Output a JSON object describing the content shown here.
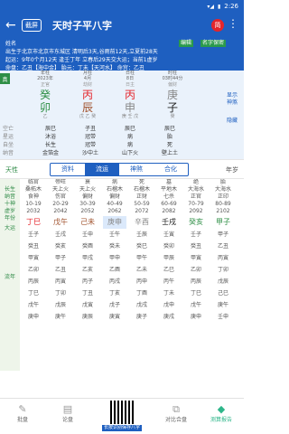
{
  "status": {
    "time": "2:26"
  },
  "header": {
    "screenshot_btn": "截屏",
    "title": "天时子平八字",
    "simp_badge": "简"
  },
  "info": {
    "line1": "姓名",
    "line2": "出生于北京市北京市东城区 清明后3天,谷雨前12天,立夏前28天",
    "line3": "起运：9年0个月12天 逢壬丁年 立春后29天交大运；当前1虚岁",
    "line4": "命盘：乙丑【海中金】 胎元：丁未【天河水】 命宫：乙丑",
    "tag1": "编辑",
    "tag2": "名字保密"
  },
  "pillars": {
    "tab": "真",
    "cols": [
      {
        "label": "年柱",
        "year": "2023年",
        "gs": "正官",
        "stem": "癸",
        "branch": "卯",
        "stem_color": "#2f8f46",
        "branch_color": "#2f8f46",
        "cang": "乙"
      },
      {
        "label": "月柱",
        "year": "4月",
        "gs": "劫财",
        "stem": "丙",
        "branch": "辰",
        "stem_color": "#e4252b",
        "branch_color": "#a0522d",
        "cang": "戊 乙 癸"
      },
      {
        "label": "日柱",
        "year": "8日",
        "gs": "日主",
        "stem": "丙",
        "branch": "申",
        "stem_color": "#e4252b",
        "branch_color": "#888",
        "cang": "庚 壬 戊"
      },
      {
        "label": "时柱",
        "year": "03时44分",
        "gs": "偏财",
        "stem": "庚",
        "branch": "子",
        "stem_color": "#888",
        "branch_color": "#222",
        "cang": "癸"
      }
    ],
    "links": [
      "显示",
      "神煞",
      "隐藏"
    ],
    "rows": [
      {
        "label": "空亡",
        "vals": [
          "辰巳",
          "子丑",
          "辰巳",
          "辰巳"
        ]
      },
      {
        "label": "星运",
        "vals": [
          "沐浴",
          "冠带",
          "病",
          "胎"
        ]
      },
      {
        "label": "自坐",
        "vals": [
          "长生",
          "冠带",
          "病",
          "死"
        ]
      },
      {
        "label": "纳音",
        "vals": [
          "金箔金",
          "沙中土",
          "山下火",
          "壁上土"
        ]
      }
    ]
  },
  "tabs": {
    "left": "天性",
    "items": [
      "资料",
      "流运",
      "神煞",
      "合化"
    ],
    "active": 1,
    "right": "年岁"
  },
  "dayun": {
    "side": [
      "长生",
      "纳音",
      "十神",
      "虚岁",
      "年份"
    ],
    "side2": "大运",
    "side3": "流年",
    "cols": [
      {
        "a": "临官",
        "b": "桑柘木",
        "c": "食神",
        "d": "10-19",
        "e": "2032",
        "gz": "丁巳",
        "g1": "#e4252b",
        "g2": "#e4252b"
      },
      {
        "a": "帝旺",
        "b": "天上火",
        "c": "伤官",
        "d": "20-29",
        "e": "2042",
        "gz": "戊午",
        "g1": "#a0522d",
        "g2": "#e4252b"
      },
      {
        "a": "衰",
        "b": "天上火",
        "c": "偏财",
        "d": "30-39",
        "e": "2052",
        "gz": "己未",
        "g1": "#a0522d",
        "g2": "#a0522d"
      },
      {
        "a": "病",
        "b": "石榴木",
        "c": "偏财",
        "d": "40-49",
        "e": "2062",
        "gz": "庚申",
        "g1": "#888",
        "g2": "#888",
        "hl": true
      },
      {
        "a": "死",
        "b": "石榴木",
        "c": "正财",
        "d": "50-59",
        "e": "2072",
        "gz": "辛酉",
        "g1": "#888",
        "g2": "#888"
      },
      {
        "a": "墓",
        "b": "平地木",
        "c": "七杀",
        "d": "60-69",
        "e": "2082",
        "gz": "壬戌",
        "g1": "#222",
        "g2": "#a0522d"
      },
      {
        "a": "绝",
        "b": "大海水",
        "c": "正官",
        "d": "70-79",
        "e": "2092",
        "gz": "癸亥",
        "g1": "#2f8f46",
        "g2": "#222"
      },
      {
        "a": "胎",
        "b": "大海水",
        "c": "正印",
        "d": "80-89",
        "e": "2102",
        "gz": "甲子",
        "g1": "#2f8f46",
        "g2": "#222"
      }
    ],
    "liunian": [
      [
        "壬子",
        "壬戌",
        "壬申",
        "壬午",
        "壬辰",
        "壬寅",
        "壬子",
        "甲子"
      ],
      [
        "癸丑",
        "癸亥",
        "癸酉",
        "癸未",
        "癸巳",
        "癸卯",
        "癸丑",
        "乙丑"
      ],
      [
        "甲寅",
        "甲子",
        "甲戌",
        "甲申",
        "甲午",
        "甲辰",
        "甲寅",
        "丙寅"
      ],
      [
        "乙卯",
        "乙丑",
        "乙亥",
        "乙酉",
        "乙未",
        "乙巳",
        "乙卯",
        "丁卯"
      ],
      [
        "丙辰",
        "丙寅",
        "丙子",
        "丙戌",
        "丙申",
        "丙午",
        "丙辰",
        "戊辰"
      ],
      [
        "丁巳",
        "丁卯",
        "丁丑",
        "丁亥",
        "丁酉",
        "丁未",
        "丁巳",
        "己巳"
      ],
      [
        "戊午",
        "戊辰",
        "戊寅",
        "戊子",
        "戊戌",
        "戊申",
        "戊午",
        "庚午"
      ],
      [
        "庚申",
        "庚午",
        "庚辰",
        "庚寅",
        "庚子",
        "庚戌",
        "庚申",
        "壬申"
      ]
    ]
  },
  "bottom": {
    "items": [
      "批盘",
      "论盘",
      "对比合盘",
      "测算报告"
    ],
    "qr": "长按识别保存八字"
  }
}
